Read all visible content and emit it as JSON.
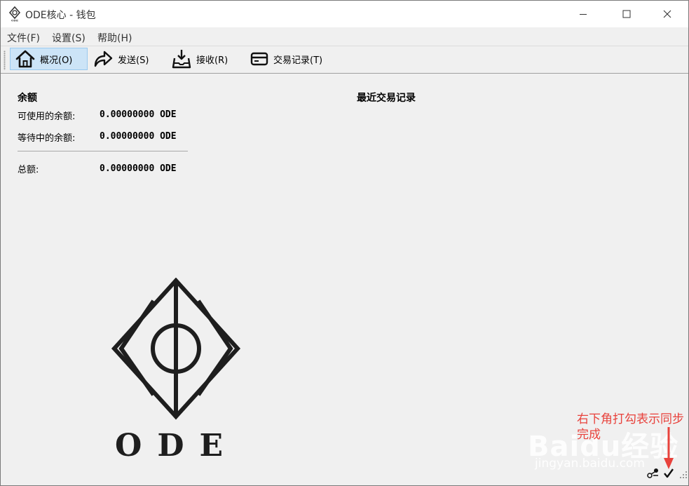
{
  "window": {
    "title": "ODE核心 - 钱包",
    "controls": [
      "minimize",
      "maximize",
      "close"
    ]
  },
  "menu": {
    "items": [
      "文件(F)",
      "设置(S)",
      "帮助(H)"
    ]
  },
  "toolbar": {
    "buttons": [
      {
        "label": "概况(O)",
        "icon": "home-icon",
        "active": true
      },
      {
        "label": "发送(S)",
        "icon": "send-arrow-icon",
        "active": false
      },
      {
        "label": "接收(R)",
        "icon": "receive-icon",
        "active": false
      },
      {
        "label": "交易记录(T)",
        "icon": "card-icon",
        "active": false
      }
    ]
  },
  "balance": {
    "title": "余额",
    "available_label": "可使用的余额:",
    "available_value": "0.00000000 ODE",
    "pending_label": "等待中的余额:",
    "pending_value": "0.00000000 ODE",
    "total_label": "总额:",
    "total_value": "0.00000000 ODE"
  },
  "recent": {
    "title": "最近交易记录"
  },
  "logo": {
    "text": "ODE"
  },
  "status": {
    "icons": [
      "network-icon",
      "sync-check-icon"
    ]
  },
  "overlay": {
    "annotation": "右下角打勾表示同步完成",
    "watermark": "Baidu经验",
    "watermark_url": "jingyan.baidu.com"
  },
  "colors": {
    "accent": "#cce4f7",
    "annotation": "#e8423c"
  }
}
